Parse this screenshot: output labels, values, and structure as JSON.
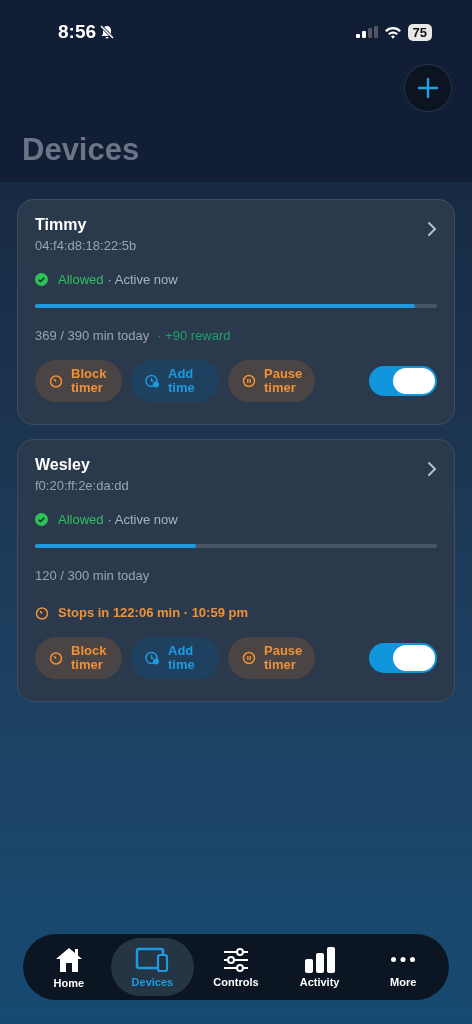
{
  "status_bar": {
    "time": "8:56",
    "battery": "75"
  },
  "title": "Devices",
  "devices": [
    {
      "name": "Timmy",
      "mac": "04:f4:d8:18:22:5b",
      "status": "Allowed",
      "activity": "· Active now",
      "level": 0.946,
      "usage": "369 / 390 min today",
      "reward": "· +90 reward",
      "actions": [
        {
          "kind": "block",
          "label": "Block timer"
        },
        {
          "kind": "add",
          "label": "Add time"
        },
        {
          "kind": "pause",
          "label": "Pause timer"
        }
      ],
      "on": true
    },
    {
      "name": "Wesley",
      "mac": "f0:20:ff:2e:da:dd",
      "status": "Allowed",
      "activity": "· Active now",
      "level": 0.4,
      "usage": "120 / 300 min today",
      "timer": "Stops in 122:06 min · 10:59 pm",
      "actions": [
        {
          "kind": "block",
          "label": "Block timer"
        },
        {
          "kind": "add",
          "label": "Add time"
        },
        {
          "kind": "pause",
          "label": "Pause timer"
        }
      ],
      "on": true
    }
  ],
  "nav": [
    {
      "kind": "home",
      "label": "Home",
      "selected": false
    },
    {
      "kind": "devices",
      "label": "Devices",
      "selected": true
    },
    {
      "kind": "controls",
      "label": "Controls",
      "selected": false
    },
    {
      "kind": "activity",
      "label": "Activity",
      "selected": false
    },
    {
      "kind": "more",
      "label": "More",
      "selected": false
    }
  ]
}
